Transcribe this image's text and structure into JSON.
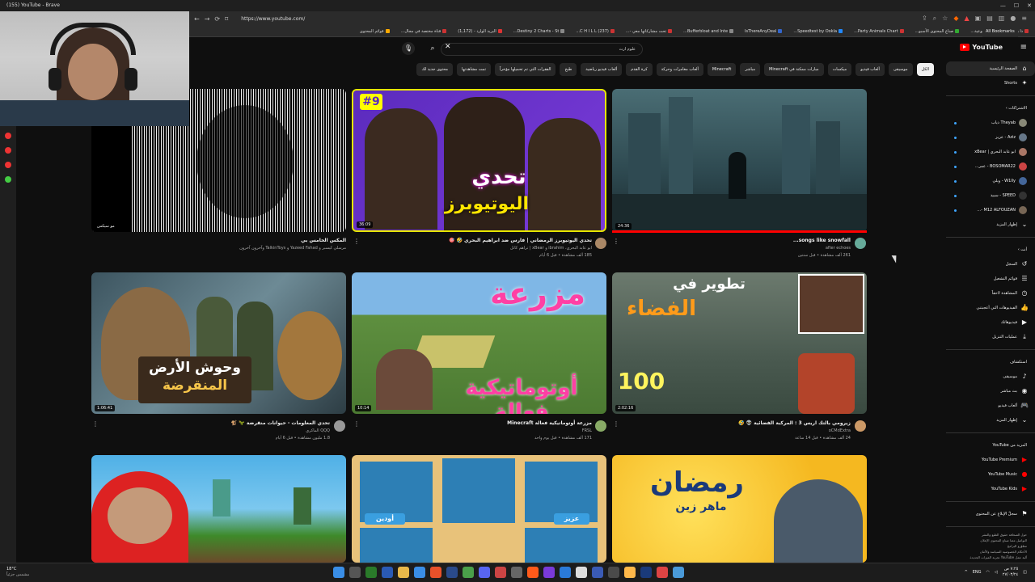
{
  "window": {
    "title": "(155) YouTube - Brave"
  },
  "address": {
    "url": "https://www.youtube.com/"
  },
  "bookmarks": [
    "ذا روتين التطبيقات الأسبوعية...",
    "صناع المحتوى الأسبو...",
    "Party Animals Chart...",
    "Speedtest by Ookla...",
    "IsThereAnyDeal",
    "Bufferbloat and Inte...",
    "تحت مشاركاتها معي -...",
    "(237) C H I L L...",
    "Destiny 2 Charts - St...",
    "البريد الوارد - (1,172)",
    "قناة مختصة في مجال...",
    "قوائم المحتوى"
  ],
  "bookmarks_all": "All Bookmarks",
  "search": {
    "value": "علوم ارث"
  },
  "logo": {
    "text": "YouTube"
  },
  "chips": [
    "الكل",
    "موسيقى",
    "ألعاب فيديو",
    "ميكسات",
    "مبارات ممكنة في Minecraft",
    "مباشر",
    "Minecraft",
    "ألعاب مغامرات وحركة",
    "كرة القدم",
    "ألعاب فيديو رياضية",
    "طبخ",
    "الفقرات التي تم تحميلها مؤخراً",
    "تمت مشاهدتها",
    "محتوى جديد لك"
  ],
  "videos": [
    {
      "title": "تحدي اليوتيوبرز الرمضاني | فارس ضد ابراهيم البحري 🤣 🎯",
      "channel": "ابو عابد البحري، ibrahim و xBear | تراهم كاتل",
      "stats": "185 ألف مشاهدة • قبل 6 أيام",
      "duration": "36:09"
    },
    {
      "title": "songs like snowfall...",
      "channel": "after echoes",
      "stats": "261 ألف مشاهدة • قبل سنتين",
      "duration": "24:36"
    },
    {
      "title": "المكس الخامس بي",
      "channel": "مرسلي كيسبر و Yazeed Fahad و TalkinToys وآخرون آخرون",
      "stats": "",
      "duration": "مو سيكس"
    },
    {
      "title": "مزرعة أوتوماتيكية فعالة Minecraft",
      "channel": "FRSL",
      "stats": "171 ألف مشاهدة • قبل يوم واحد",
      "duration": "10:14"
    },
    {
      "title": "زيرومي بالتك اريس 3 : المركبة الفضائية 👽 🤣",
      "channel": "oCMdExtra",
      "stats": "24 ألف مشاهدة • قبل 14 ساعة",
      "duration": "2:02:16"
    },
    {
      "title": "تحدي المعلومات - حيوانات منقرضة 🦖 🐒",
      "channel": "QQQ الماكري",
      "stats": "1.8 مليون مشاهدة • قبل 6 أيام",
      "duration": "1:06:41"
    }
  ],
  "thumbtext": {
    "v1a": "تحدي",
    "v1b": "اليوتيوبرز",
    "v1c": "#9",
    "v4a": "مزرعة",
    "v4b": "أوتوماتيكية فعالة",
    "v5a": "تطوير في",
    "v5b": "الفضاء",
    "v5c": "100",
    "v6a": "وحوش الأرض",
    "v6b": "المنقرضة",
    "v9a": "رمضان",
    "v9b": "ماهر زين",
    "v8a": "أودين",
    "v8b": "عزيز"
  },
  "sidebar": {
    "home": "الصفحة الرئيسية",
    "shorts": "Shorts",
    "subs_head": "الاشتراكات",
    "channels": [
      "Theyab ذياب",
      "Aziz - عزيز",
      "ابو عابد البحري | xBear",
      "BOSOMAR22 - عمر...",
      "W1lly - ويلي",
      "SPEED - سبيد",
      "M12 ALFOUZAN -..."
    ],
    "show_more": "إظهار المزيد",
    "you_head": "أنت",
    "you_items": [
      "السجل",
      "قوائم التشغيل",
      "المشاهدة لاحقاً",
      "الفيديوهات التي أعجبتني",
      "فيديوهاتك",
      "عمليات التنزيل"
    ],
    "explore_head": "استكشاف",
    "explore_items": [
      "موسيقى",
      "بث مباشر",
      "ألعاب فيديو"
    ],
    "explore_more": "إظهار المزيد",
    "more_head": "المزيد من YouTube",
    "more_items": [
      "YouTube Premium",
      "YouTube Music",
      "YouTube Kids"
    ],
    "report": "سجلّ الإبلاغ عن المحتوى",
    "footer1": "حول الصحافة حقوق الطبع والنشر",
    "footer2": "التواصل معنا صناع المحتوى الإعلان",
    "footer3": "مطوّرو البرامج",
    "footer4": "الأحكام الخصوصية السياسة والأمان",
    "footer5": "آلية عمل YouTube تجربة الميزات الجديدة"
  },
  "taskbar": {
    "temp": "18°C",
    "weather": "مشمس جزئياً",
    "lang": "ENG",
    "time": "٧:٢٥ ص",
    "date": "٢٧/٠٣/٢٤"
  }
}
